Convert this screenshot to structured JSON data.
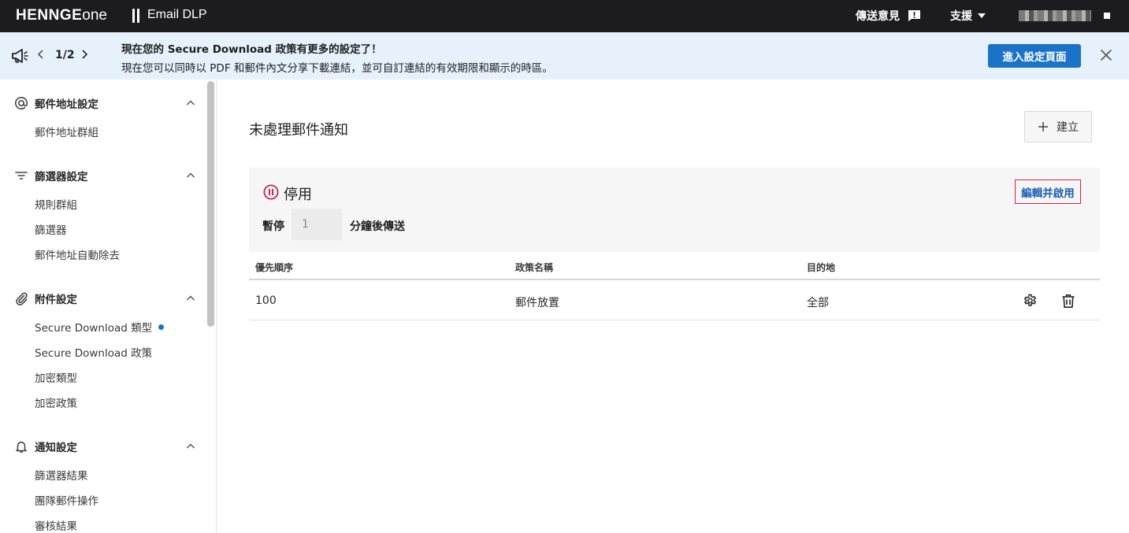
{
  "topbar": {
    "logo_main": "HENNGE",
    "logo_suffix": "one",
    "product": "Email DLP",
    "feedback": "傳送意見",
    "support": "支援"
  },
  "banner": {
    "pager": "1/2",
    "title": "現在您的 Secure Download 政策有更多的設定了！",
    "body": "現在您可以同時以 PDF 和郵件內文分享下載連結，並可自訂連結的有效期限和顯示的時區。",
    "button": "進入設定頁面"
  },
  "sidebar": {
    "sections": [
      {
        "title": "郵件地址設定",
        "icon": "at-icon",
        "items": [
          "郵件地址群組"
        ]
      },
      {
        "title": "篩選器設定",
        "icon": "filter-icon",
        "items": [
          "規則群組",
          "篩選器",
          "郵件地址自動除去"
        ]
      },
      {
        "title": "附件設定",
        "icon": "paperclip-icon",
        "items": [
          "Secure Download 類型",
          "Secure Download 政策",
          "加密類型",
          "加密政策"
        ]
      },
      {
        "title": "通知設定",
        "icon": "bell-icon",
        "items": [
          "篩選器結果",
          "團隊郵件操作",
          "審核結果"
        ]
      }
    ]
  },
  "main": {
    "title": "未處理郵件通知",
    "create_button": "建立",
    "status": "停用",
    "edit_link": "編輯并啟用",
    "pause_label": "暫停",
    "pause_value": "1",
    "pause_suffix": "分鐘後傳送",
    "table": {
      "headers": [
        "優先順序",
        "政策名稱",
        "目的地"
      ],
      "rows": [
        {
          "priority": "100",
          "policy": "郵件放置",
          "destination": "全部"
        }
      ]
    }
  },
  "colors": {
    "topbar_bg": "#1c1c1e",
    "banner_bg": "#e6f1fb",
    "primary": "#1a73c9",
    "disabled_red": "#c6284a",
    "link_blue": "#1a5fb4"
  }
}
